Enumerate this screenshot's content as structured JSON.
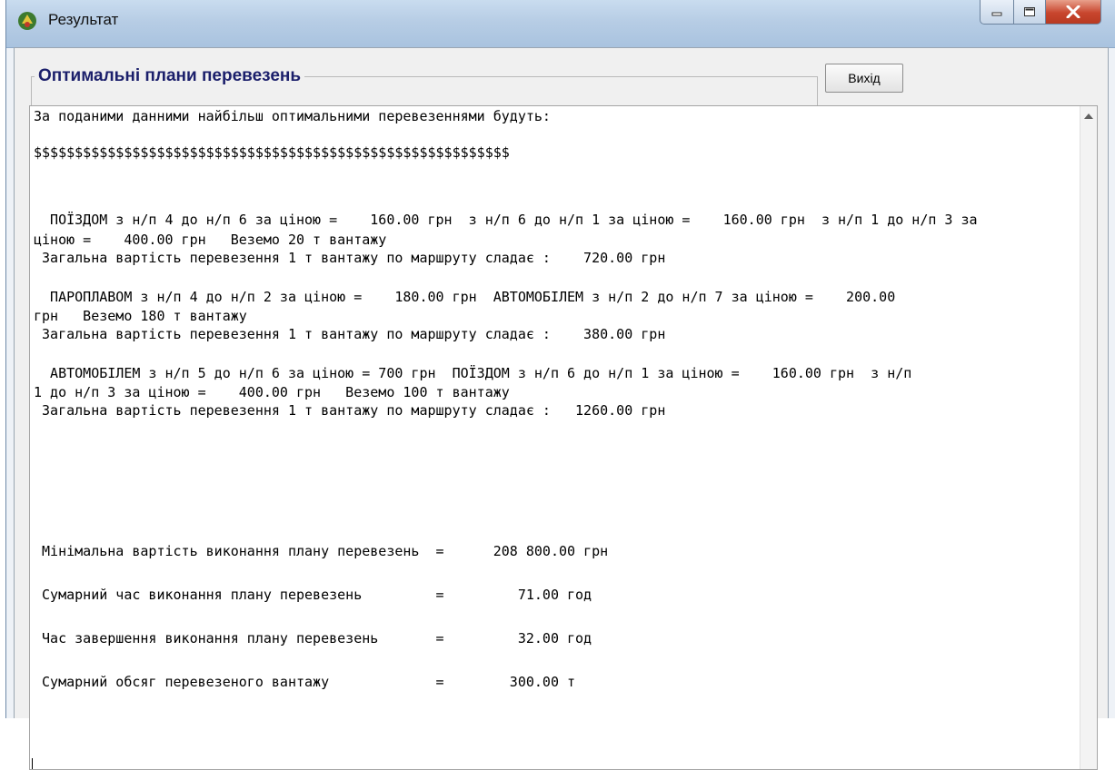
{
  "window": {
    "title": "Результат",
    "group_title": "Оптимальні плани перевезень",
    "exit_label": "Вихід",
    "accent_color": "#1b1f6b"
  },
  "memo": {
    "lines": [
      "За поданими данними найбільш оптимальними перевезеннями будуть:",
      "$$$$$$$$$$$$$$$$$$$$$$$$$$$$$$$$$$$$$$$$$$$$$$$$$$$$$$$$$$",
      "  ПОЇЗДОМ з н/п 4 до н/п 6 за ціною =    160.00 грн  з н/п 6 до н/п 1 за ціною =    160.00 грн  з н/п 1 до н/п 3 за",
      "ціною =    400.00 грн   Веземо 20 т вантажу",
      " Загальна вартість перевезення 1 т вантажу по маршруту сладає :    720.00 грн",
      "  ПАРОПЛАВОМ з н/п 4 до н/п 2 за ціною =    180.00 грн  АВТОМОБІЛЕМ з н/п 2 до н/п 7 за ціною =    200.00",
      "грн   Веземо 180 т вантажу",
      " Загальна вартість перевезення 1 т вантажу по маршруту сладає :    380.00 грн",
      "  АВТОМОБІЛЕМ з н/п 5 до н/п 6 за ціною = 700 грн  ПОЇЗДОМ з н/п 6 до н/п 1 за ціною =    160.00 грн  з н/п",
      "1 до н/п 3 за ціною =    400.00 грн   Веземо 100 т вантажу",
      " Загальна вартість перевезення 1 т вантажу по маршруту сладає :   1260.00 грн",
      " Мінімальна вартість виконання плану перевезень  =      208 800.00 грн",
      " Сумарний час виконання плану перевезень         =         71.00 год",
      " Час завершення виконання плану перевезень       =         32.00 год",
      " Сумарний обсяг перевезеного вантажу             =        300.00 т"
    ]
  }
}
